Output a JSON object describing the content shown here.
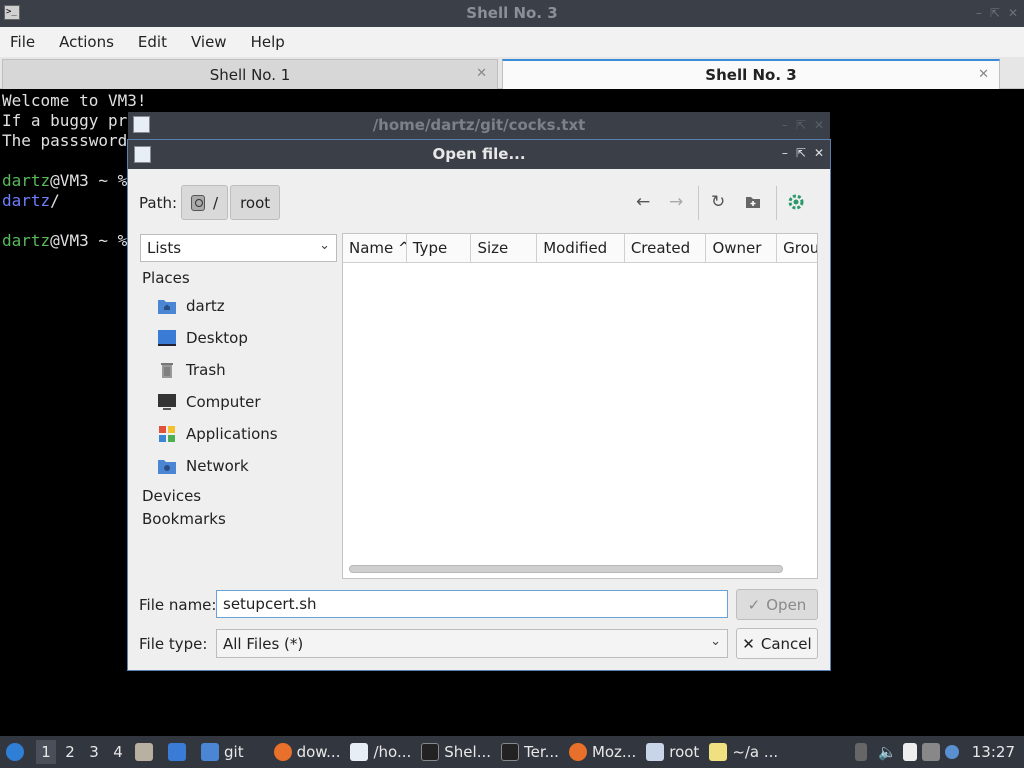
{
  "terminal": {
    "title": "Shell No. 3",
    "menu": [
      "File",
      "Actions",
      "Edit",
      "View",
      "Help"
    ],
    "tabs": [
      {
        "label": "Shell No. 1",
        "active": false
      },
      {
        "label": "Shell No. 3",
        "active": true
      }
    ],
    "lines": {
      "l1": "Welcome to VM3!",
      "l2": "If a buggy pr",
      "l3": "The passsword",
      "l5_user": "dartz",
      "l5_host": "@VM3 ~ %",
      "l6_dir": "dartz",
      "l6_rest": "/",
      "l8_user": "dartz",
      "l8_host": "@VM3 ~ %"
    }
  },
  "editor_window": {
    "title": "/home/dartz/git/cocks.txt"
  },
  "dialog": {
    "title": "Open file...",
    "path_label": "Path:",
    "path_segments": [
      "/",
      "root"
    ],
    "view_mode": "Lists",
    "sidebar": {
      "places_heading": "Places",
      "places": [
        {
          "label": "dartz",
          "icon": "home-folder-icon"
        },
        {
          "label": "Desktop",
          "icon": "desktop-icon"
        },
        {
          "label": "Trash",
          "icon": "trash-icon"
        },
        {
          "label": "Computer",
          "icon": "computer-icon"
        },
        {
          "label": "Applications",
          "icon": "applications-icon"
        },
        {
          "label": "Network",
          "icon": "network-icon"
        }
      ],
      "devices_heading": "Devices",
      "bookmarks_heading": "Bookmarks"
    },
    "columns": [
      "Name ^",
      "Type",
      "Size",
      "Modified",
      "Created",
      "Owner",
      "Grou"
    ],
    "file_name_label": "File name:",
    "file_name_value": "setupcert.sh",
    "open_label": "Open",
    "file_type_label": "File type:",
    "file_type_value": "All Files (*)",
    "cancel_label": "Cancel"
  },
  "taskbar": {
    "desktops": [
      "1",
      "2",
      "3",
      "4"
    ],
    "active_desktop": "1",
    "tasks": [
      {
        "label": "git"
      },
      {
        "label": "dow..."
      },
      {
        "label": "/ho..."
      },
      {
        "label": "Shel..."
      },
      {
        "label": "Ter..."
      },
      {
        "label": "Moz..."
      },
      {
        "label": "root"
      },
      {
        "label": "~/a ..."
      }
    ],
    "clock": "13:27"
  },
  "colors": {
    "titlebar": "#3b3f48",
    "taskbar": "#32363e",
    "accent": "#3a8bd8",
    "prompt_green": "#58b85a",
    "dir_blue": "#6f7dff"
  }
}
